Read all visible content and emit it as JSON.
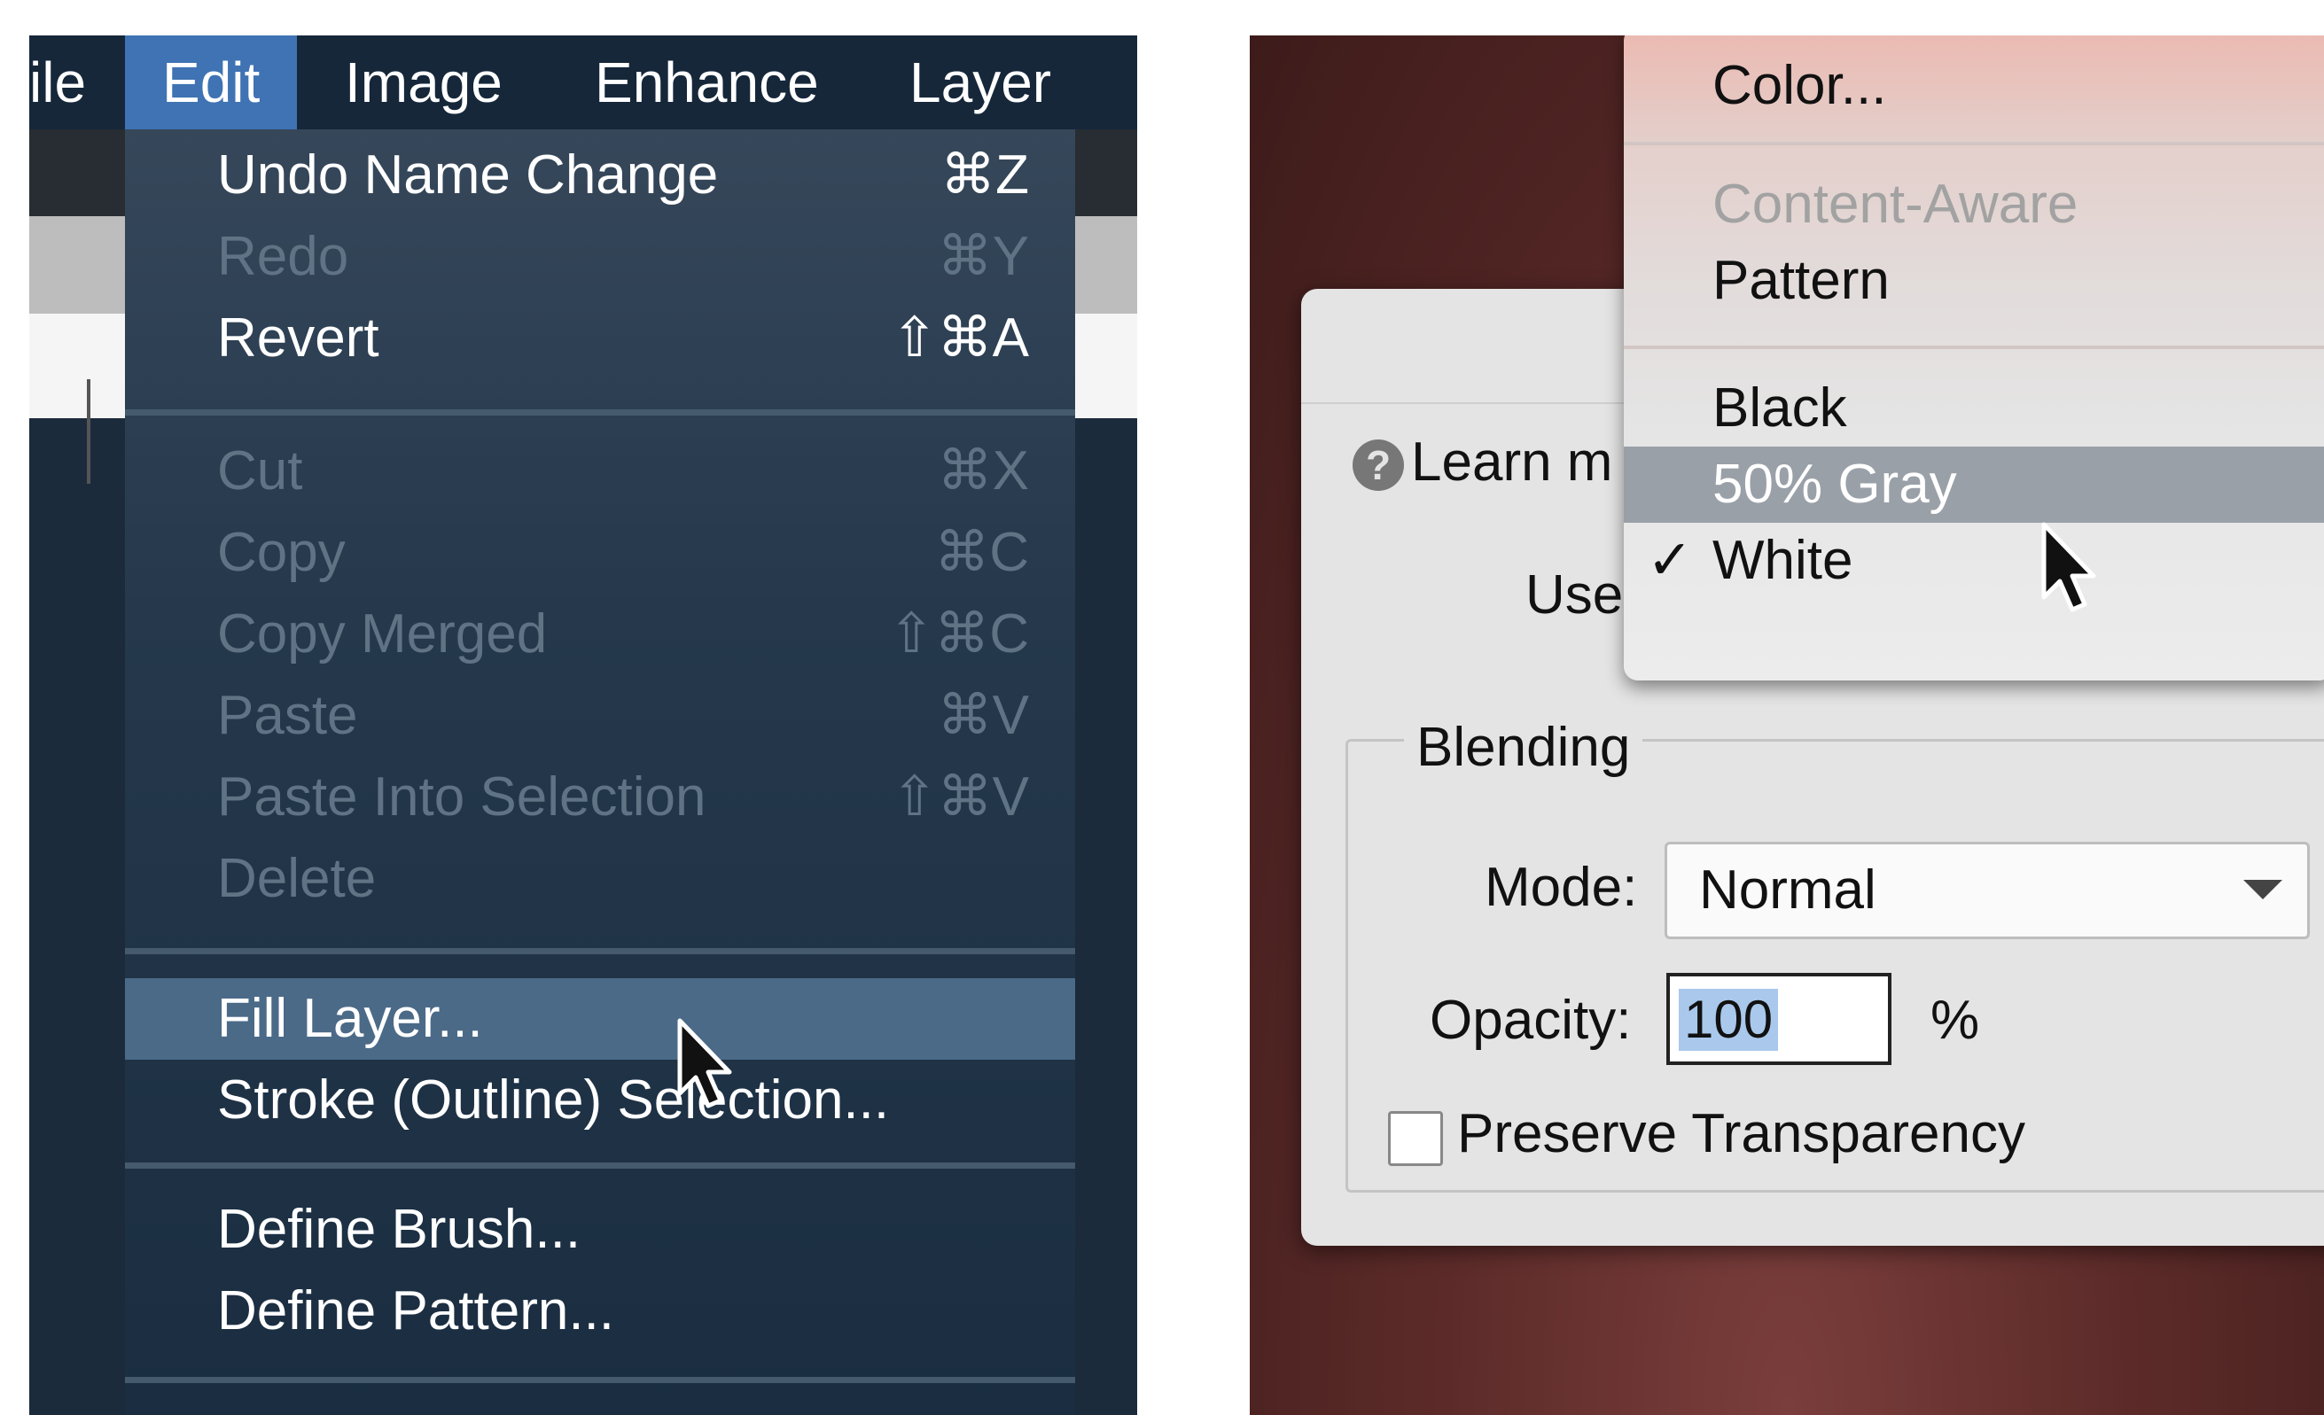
{
  "menubar": {
    "items": [
      {
        "label": "ile"
      },
      {
        "label": "Edit"
      },
      {
        "label": "Image"
      },
      {
        "label": "Enhance"
      },
      {
        "label": "Layer"
      }
    ]
  },
  "edit_menu": {
    "items": [
      {
        "label": "Undo Name Change",
        "shortcut": "⌘Z",
        "enabled": true
      },
      {
        "label": "Redo",
        "shortcut": "⌘Y",
        "enabled": false
      },
      {
        "label": "Revert",
        "shortcut": "⇧⌘A",
        "enabled": true
      },
      {
        "label": "Cut",
        "shortcut": "⌘X",
        "enabled": false
      },
      {
        "label": "Copy",
        "shortcut": "⌘C",
        "enabled": false
      },
      {
        "label": "Copy Merged",
        "shortcut": "⇧⌘C",
        "enabled": false
      },
      {
        "label": "Paste",
        "shortcut": "⌘V",
        "enabled": false
      },
      {
        "label": "Paste Into Selection",
        "shortcut": "⇧⌘V",
        "enabled": false
      },
      {
        "label": "Delete",
        "shortcut": "",
        "enabled": false
      },
      {
        "label": "Fill Layer...",
        "shortcut": "",
        "enabled": true,
        "highlighted": true
      },
      {
        "label": "Stroke (Outline) Selection...",
        "shortcut": "",
        "enabled": true
      },
      {
        "label": "Define Brush...",
        "shortcut": "",
        "enabled": true
      },
      {
        "label": "Define Pattern...",
        "shortcut": "",
        "enabled": true
      }
    ]
  },
  "fill_dialog": {
    "learn_more": "Learn m",
    "use_label": "Use",
    "use_options": [
      {
        "label": "Color...",
        "enabled": true
      },
      {
        "label": "Content-Aware",
        "enabled": false
      },
      {
        "label": "Pattern",
        "enabled": true
      },
      {
        "label": "Black",
        "enabled": true
      },
      {
        "label": "50% Gray",
        "enabled": true,
        "highlighted": true
      },
      {
        "label": "White",
        "enabled": true,
        "checked": true
      }
    ],
    "checkmark": "✓",
    "blending": {
      "legend": "Blending",
      "mode_label": "Mode:",
      "mode_value": "Normal",
      "opacity_label": "Opacity:",
      "opacity_value": "100",
      "opacity_unit": "%",
      "preserve_label": "Preserve Transparency",
      "preserve_checked": false
    }
  },
  "icons": {
    "help": "?"
  }
}
